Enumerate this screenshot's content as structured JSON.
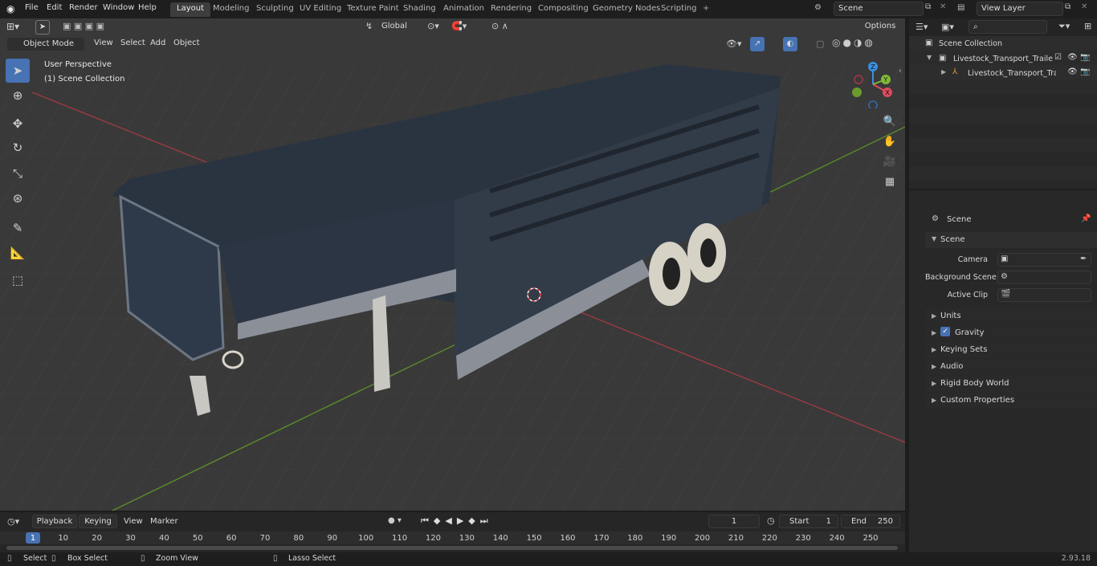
{
  "topbar": {
    "menus": [
      "File",
      "Edit",
      "Render",
      "Window",
      "Help"
    ],
    "workspaces": [
      "Layout",
      "Modeling",
      "Sculpting",
      "UV Editing",
      "Texture Paint",
      "Shading",
      "Animation",
      "Rendering",
      "Compositing",
      "Geometry Nodes",
      "Scripting"
    ],
    "add_tab": "+",
    "scene_field": "Scene",
    "view_layer_field": "View Layer"
  },
  "viewport_toolbar": {
    "transform_orientation": "Global",
    "options": "Options"
  },
  "viewport_header": {
    "mode": "Object Mode",
    "menus": [
      "View",
      "Select",
      "Add",
      "Object"
    ]
  },
  "viewport": {
    "perspective_label": "User Perspective",
    "collection_label": "(1) Scene Collection",
    "gizmo_axes": {
      "x": "X",
      "y": "Y",
      "z": "Z"
    }
  },
  "outliner": {
    "root": "Scene Collection",
    "items": [
      {
        "label": "Livestock_Transport_Trailer_L"
      },
      {
        "label": "Livestock_Transport_Trai"
      }
    ]
  },
  "properties": {
    "breadcrumb": "Scene",
    "panel_title": "Scene",
    "fields": [
      {
        "label": "Camera",
        "value": ""
      },
      {
        "label": "Background Scene",
        "value": ""
      },
      {
        "label": "Active Clip",
        "value": ""
      }
    ],
    "sections": [
      "Units",
      "Gravity",
      "Keying Sets",
      "Audio",
      "Rigid Body World",
      "Custom Properties"
    ]
  },
  "timeline": {
    "menus": [
      "Playback",
      "Keying",
      "View",
      "Marker"
    ],
    "current_frame": "1",
    "start_label": "Start",
    "start_value": "1",
    "end_label": "End",
    "end_value": "250",
    "ruler": [
      "1",
      "10",
      "20",
      "30",
      "40",
      "50",
      "60",
      "70",
      "80",
      "90",
      "100",
      "110",
      "120",
      "130",
      "140",
      "150",
      "160",
      "170",
      "180",
      "190",
      "200",
      "210",
      "220",
      "230",
      "240",
      "250"
    ]
  },
  "statusbar": {
    "hints": [
      "Select",
      "Box Select",
      "Zoom View",
      "Lasso Select"
    ],
    "version": "2.93.18"
  },
  "colors": {
    "accent": "#4772b3",
    "axis_x": "#e04a5c",
    "axis_y": "#7fb935",
    "axis_z": "#3b8ee0"
  }
}
